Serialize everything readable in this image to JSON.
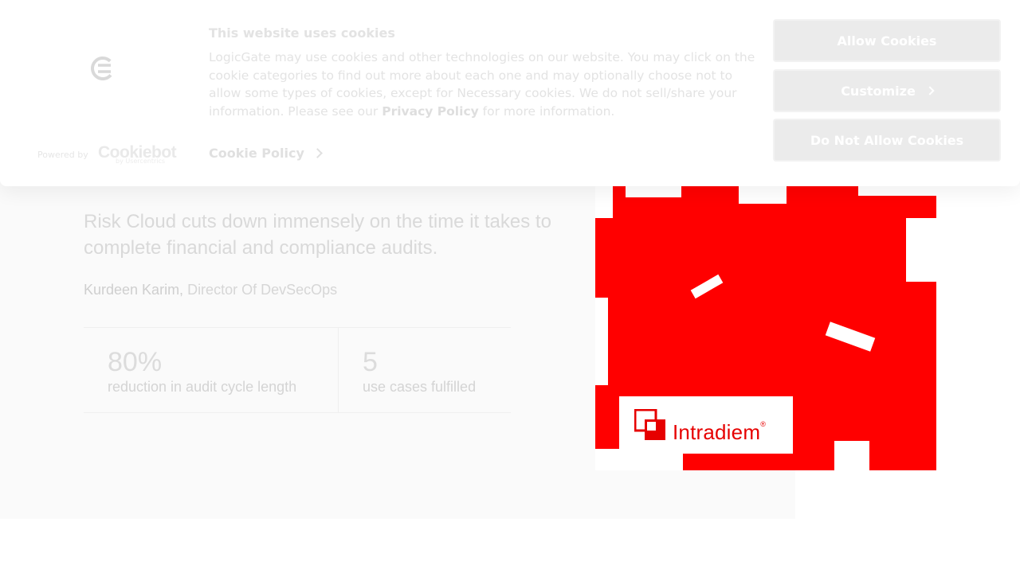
{
  "cookie_banner": {
    "title": "This website uses cookies",
    "body_part1": "LogicGate may use cookies and other technologies on our website. You may click on the cookie categories to find out more about each one and may optionally choose not to allow some types of cookies, except for Necessary cookies.  We do not sell/share your information. Please see our ",
    "privacy_link": "Privacy Policy",
    "body_part2": " for more information.",
    "cookie_policy_link": "Cookie Policy",
    "powered_by": "Powered by",
    "cookiebot_brand": "Cookiebot",
    "cookiebot_sub": "by Usercentrics",
    "buttons": {
      "allow": "Allow Cookies",
      "customize": "Customize",
      "deny": "Do Not Allow Cookies"
    }
  },
  "testimonial": {
    "quote": "Risk Cloud cuts down immensely on the time it takes to complete financial and compliance audits.",
    "author_name": "Kurdeen Karim,",
    "author_title": " Director Of DevSecOps",
    "stats": [
      {
        "value": "80%",
        "label": "reduction in audit cycle length"
      },
      {
        "value": "5",
        "label": "use cases fulfilled"
      }
    ],
    "photo_logo_text": "Intradiem",
    "photo_logo_reg": "®"
  },
  "icons": {
    "site_logo": "logicgate-logo-icon",
    "chevron": "chevron-right-icon"
  },
  "colors": {
    "photo_red": "#ff0000",
    "banner_bg": "#ffffff",
    "button_bg": "#ebebeb"
  }
}
